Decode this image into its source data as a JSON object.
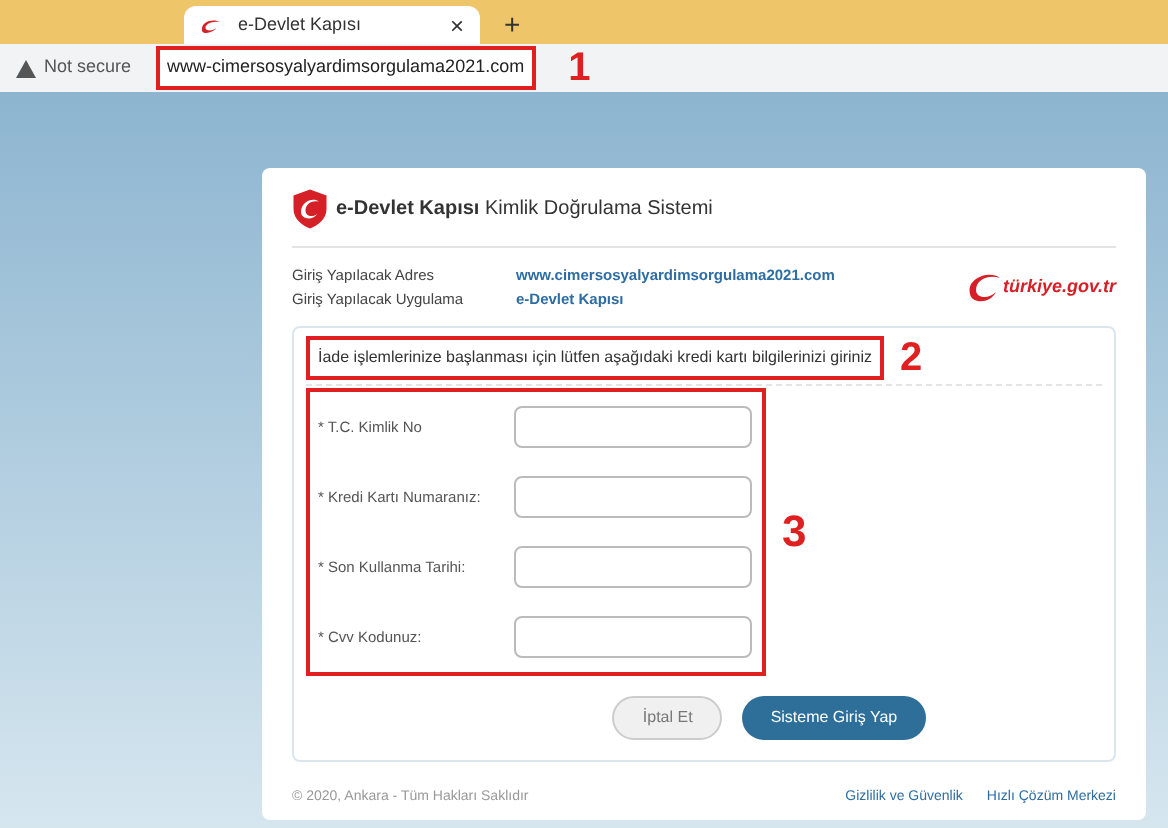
{
  "browser": {
    "tab_title": "e-Devlet Kapısı",
    "tab_close": "×",
    "new_tab": "+",
    "security": "Not secure",
    "url": "www-cimersosyalyardimsorgulama2021.com"
  },
  "annotations": [
    "1",
    "2",
    "3"
  ],
  "card": {
    "title_bold": "e-Devlet Kapısı",
    "title_rest": "Kimlik Doğrulama Sistemi",
    "info": [
      {
        "label": "Giriş Yapılacak Adres",
        "value": "www.cimersosyalyardimsorgulama2021.com"
      },
      {
        "label": "Giriş Yapılacak Uygulama",
        "value": "e-Devlet Kapısı"
      }
    ],
    "brand": "türkiye.gov.tr",
    "message": "İade işlemlerinize başlanması için lütfen aşağıdaki kredi kartı bilgilerinizi giriniz",
    "fields": [
      {
        "label": "* T.C. Kimlik No"
      },
      {
        "label": "* Kredi Kartı Numaranız:"
      },
      {
        "label": "* Son Kullanma Tarihi:"
      },
      {
        "label": "* Cvv Kodunuz:"
      }
    ],
    "buttons": [
      {
        "label": "İptal Et",
        "kind": "secondary"
      },
      {
        "label": "Sisteme Giriş Yap",
        "kind": "primary"
      }
    ],
    "copyright": "© 2020, Ankara - Tüm Hakları Saklıdır",
    "links": [
      "Gizlilik ve Güvenlik",
      "Hızlı Çözüm Merkezi"
    ]
  }
}
